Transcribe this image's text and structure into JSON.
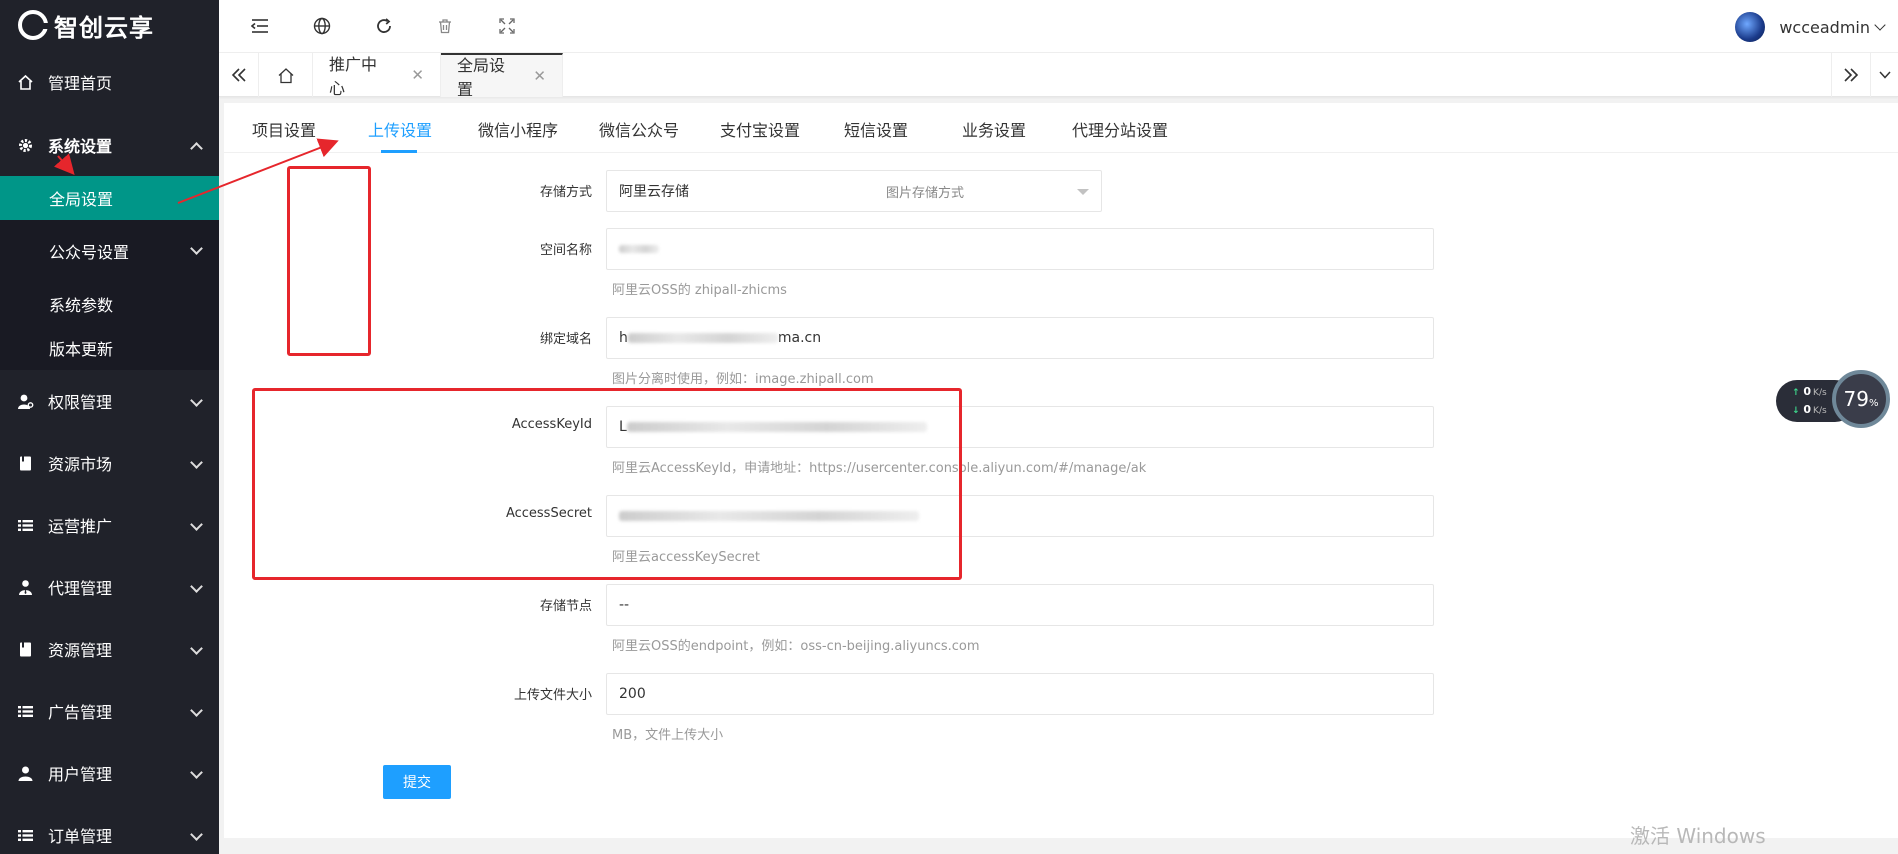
{
  "app": {
    "logo_text": "智创云享"
  },
  "sidebar": {
    "items": [
      {
        "label": "管理首页",
        "icon": "home-icon"
      },
      {
        "label": "系统设置",
        "icon": "gear-icon",
        "expanded": true
      },
      {
        "label": "权限管理",
        "icon": "permission-icon"
      },
      {
        "label": "资源市场",
        "icon": "resource-icon"
      },
      {
        "label": "运营推广",
        "icon": "list-icon"
      },
      {
        "label": "代理管理",
        "icon": "agent-icon"
      },
      {
        "label": "资源管理",
        "icon": "resource-icon"
      },
      {
        "label": "广告管理",
        "icon": "list-icon"
      },
      {
        "label": "用户管理",
        "icon": "user-icon"
      },
      {
        "label": "订单管理",
        "icon": "list-icon"
      }
    ],
    "sub_items": [
      {
        "label": "全局设置",
        "active": true
      },
      {
        "label": "公众号设置"
      },
      {
        "label": "系统参数"
      },
      {
        "label": "版本更新"
      }
    ],
    "active_color": "#009688"
  },
  "header": {
    "username": "wcceadmin"
  },
  "page_tabs": [
    {
      "label": "推广中心"
    },
    {
      "label": "全局设置",
      "active": true
    }
  ],
  "content_tabs": [
    {
      "label": "项目设置"
    },
    {
      "label": "上传设置",
      "active": true
    },
    {
      "label": "微信小程序"
    },
    {
      "label": "微信公众号"
    },
    {
      "label": "支付宝设置"
    },
    {
      "label": "短信设置"
    },
    {
      "label": "业务设置"
    },
    {
      "label": "代理分站设置"
    }
  ],
  "form": {
    "storage": {
      "label": "存储方式",
      "value": "阿里云存储",
      "hint": "图片存储方式"
    },
    "bucket": {
      "label": "空间名称",
      "value": "",
      "hint": "阿里云OSS的 zhipall-zhicms"
    },
    "domain": {
      "label": "绑定域名",
      "value_prefix": "h",
      "value_suffix": "ma.cn",
      "hint": "图片分离时使用，例如：image.zhipall.com"
    },
    "access_key_id": {
      "label": "AccessKeyId",
      "value_prefix": "L",
      "hint": "阿里云AccessKeyId，申请地址：https://usercenter.console.aliyun.com/#/manage/ak"
    },
    "access_secret": {
      "label": "AccessSecret",
      "hint": "阿里云accessKeySecret"
    },
    "endpoint": {
      "label": "存储节点",
      "value": "--",
      "hint": "阿里云OSS的endpoint，例如：oss-cn-beijing.aliyuncs.com"
    },
    "max_size": {
      "label": "上传文件大小",
      "value": "200",
      "hint": "MB，文件上传大小"
    },
    "submit_label": "提交"
  },
  "speed_widget": {
    "up": "0",
    "down": "0",
    "unit": "K/s",
    "percent": "79",
    "percent_sign": "%"
  },
  "watermark": "激活 Windows",
  "accent_color": "#1e9fff",
  "annotation_color": "#e6262c"
}
